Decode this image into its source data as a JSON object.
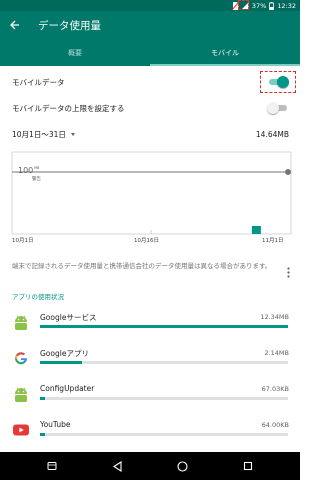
{
  "status_bar": {
    "battery": "37%",
    "time": "12:32"
  },
  "app_bar": {
    "title": "データ使用量"
  },
  "tabs": [
    {
      "label": "概要"
    },
    {
      "label": "モバイル"
    }
  ],
  "settings": {
    "mobile_data": {
      "label": "モバイルデータ",
      "enabled": true
    },
    "data_limit": {
      "label": "モバイルデータの上限を設定する",
      "enabled": false
    }
  },
  "cycle": {
    "range": "10月1日〜31日",
    "total": "14.64MB"
  },
  "chart_data": {
    "type": "bar",
    "warning_value": "100",
    "warning_unit": "MB",
    "warning_label": "警告",
    "x_ticks": [
      "10月1日",
      "10月16日",
      "11月1日"
    ],
    "categories": [
      "10月1日",
      "10月16日",
      "11月1日"
    ],
    "usage_mb": 14.64,
    "bar_position": 0.88,
    "ylim_mb": [
      0,
      100
    ]
  },
  "note": "端末で記録されるデータ使用量と携帯通信会社のデータ使用量は異なる場合があります。",
  "section_title": "アプリの使用状況",
  "apps": [
    {
      "name": "Googleサービス",
      "size": "12.34MB",
      "usage_fraction": 1.0,
      "icon": "android-icon"
    },
    {
      "name": "Googleアプリ",
      "size": "2.14MB",
      "usage_fraction": 0.17,
      "icon": "google-g-icon"
    },
    {
      "name": "ConfigUpdater",
      "size": "67.03KB",
      "usage_fraction": 0.02,
      "icon": "android-icon"
    },
    {
      "name": "YouTube",
      "size": "64.00KB",
      "usage_fraction": 0.02,
      "icon": "youtube-icon"
    }
  ],
  "colors": {
    "accent": "#009688",
    "app_bar": "#00796b",
    "status_bar": "#00695c",
    "marker": "#d32f2f"
  }
}
